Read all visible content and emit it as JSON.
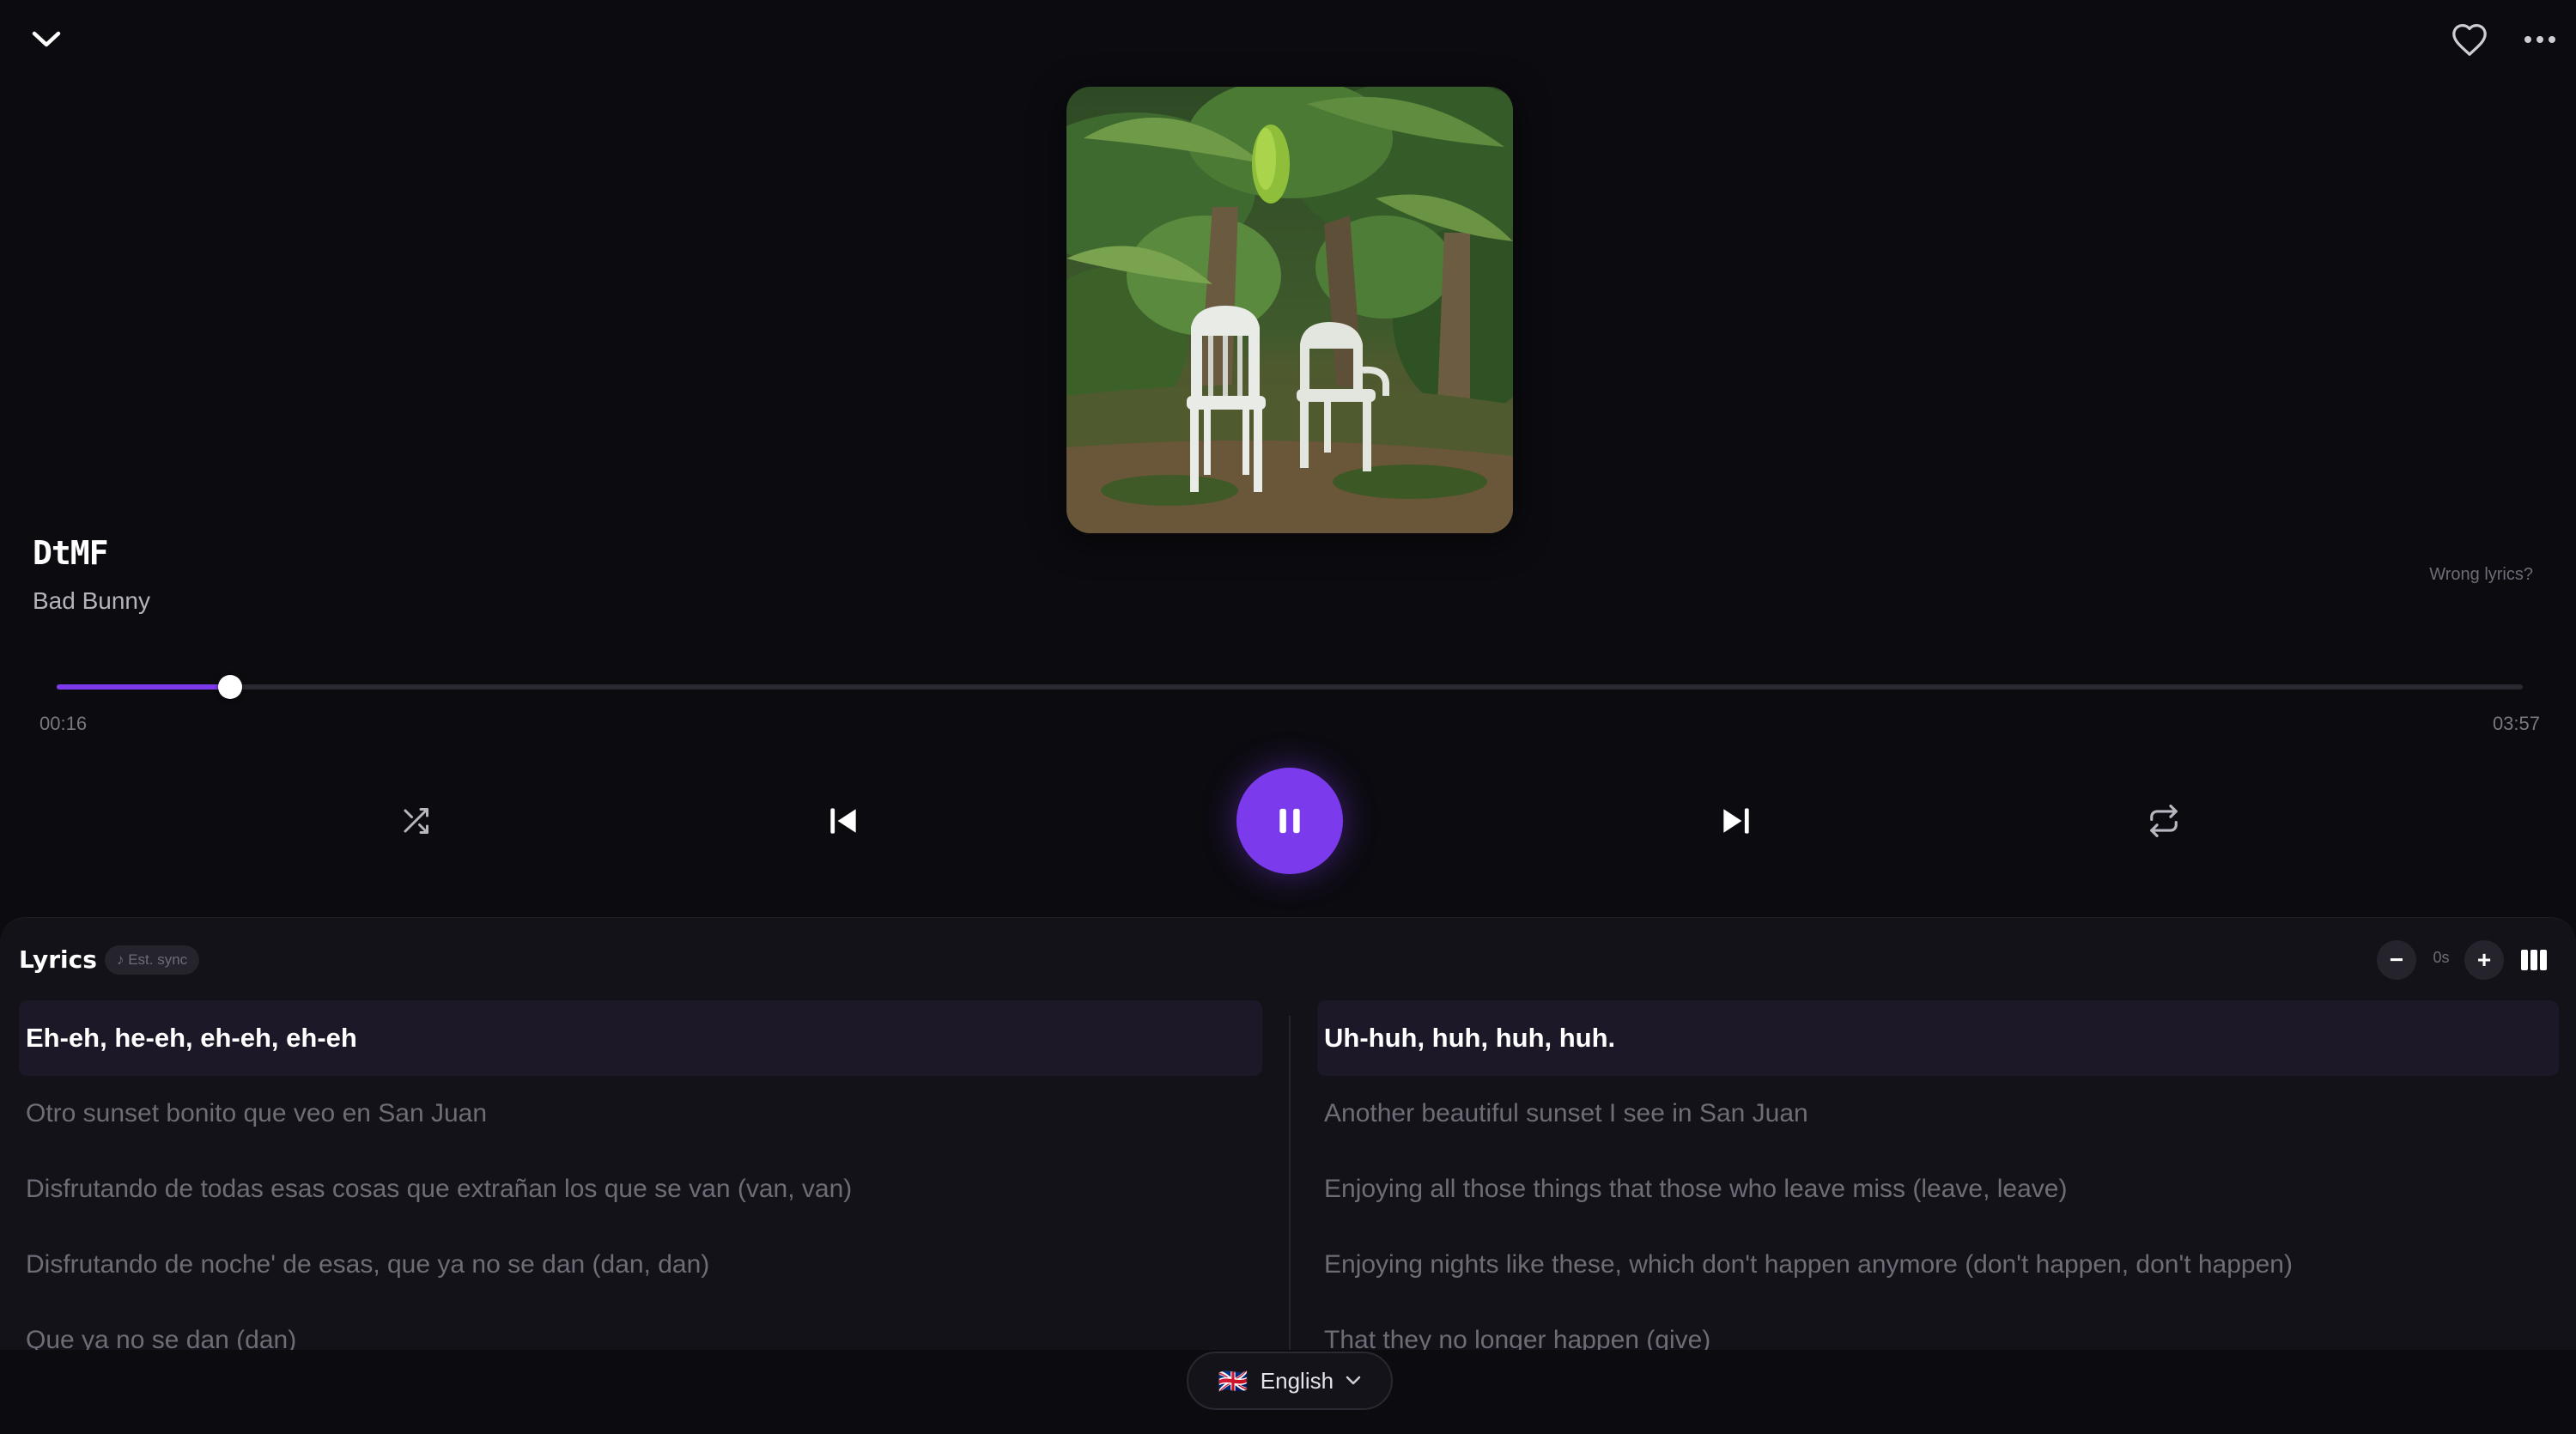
{
  "track": {
    "title": "DtMF",
    "artist": "Bad Bunny"
  },
  "wrong_lyrics_link": "Wrong lyrics?",
  "progress": {
    "elapsed": "00:16",
    "total": "03:57",
    "fraction": 0.0703
  },
  "controls": {
    "shuffle_icon": "shuffle-icon",
    "prev_icon": "skip-previous-icon",
    "play_state_icon": "pause-icon",
    "next_icon": "skip-next-icon",
    "repeat_icon": "repeat-icon"
  },
  "lyrics": {
    "header": "Lyrics",
    "sync_badge": "♪ Est. sync",
    "offset_minus": "−",
    "offset_value": "0s",
    "offset_plus": "+",
    "original": [
      "Eh-eh, he-eh, eh-eh, eh-eh",
      "Otro sunset bonito que veo en San Juan",
      "Disfrutando de todas esas cosas que extrañan los que se van (van, van)",
      "Disfrutando de noche' de esas, que ya no se dan (dan, dan)",
      "Que ya no se dan (dan)"
    ],
    "translation": [
      "Uh-huh, huh, huh, huh.",
      "Another beautiful sunset I see in San Juan",
      "Enjoying all those things that those who leave miss (leave, leave)",
      "Enjoying nights like these, which don't happen anymore (don't happen, don't happen)",
      "That they no longer happen (give)"
    ]
  },
  "language": {
    "flag": "🇬🇧",
    "selected": "English"
  },
  "colors": {
    "accent": "#7c3aed",
    "background": "#0c0b10",
    "panel": "#131218"
  }
}
